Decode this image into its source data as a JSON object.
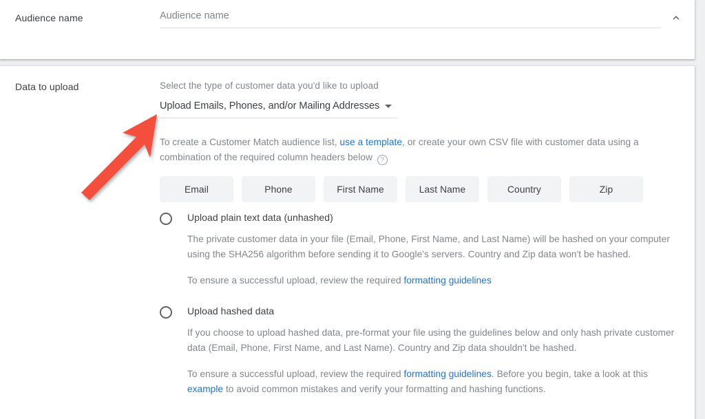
{
  "audience_section": {
    "label": "Audience name",
    "input_placeholder": "Audience name",
    "input_value": "",
    "collapse_icon": "chevron-up-icon"
  },
  "data_section": {
    "label": "Data to upload",
    "select_hint": "Select the type of customer data you'd like to upload",
    "type_select": {
      "value": "Upload Emails, Phones, and/or Mailing Addresses",
      "caret_icon": "chevron-down-icon"
    },
    "description": {
      "part1": "To create a Customer Match audience list, ",
      "link": "use a template",
      "part2": ", or create your own CSV file with customer data using a combination of the required column headers below ",
      "help_icon": "help-circle-icon",
      "help_glyph": "?"
    },
    "column_header_chips": [
      "Email",
      "Phone",
      "First Name",
      "Last Name",
      "Country",
      "Zip"
    ],
    "options": [
      {
        "id": "plain",
        "title": "Upload plain text data (unhashed)",
        "selected": false,
        "paragraph1": "The private customer data in your file (Email, Phone, First Name, and Last Name) will be hashed on your computer using the SHA256 algorithm before sending it to Google's servers. Country and Zip data won't be hashed.",
        "paragraph2_pre": "To ensure a successful upload, review the required ",
        "paragraph2_link": "formatting guidelines",
        "paragraph2_post": ""
      },
      {
        "id": "hashed",
        "title": "Upload hashed data",
        "selected": false,
        "paragraph1": "If you choose to upload hashed data, pre-format your file using the guidelines below and only hash private customer data (Email, Phone, First Name, and Last Name). Country and Zip data shouldn't be hashed.",
        "paragraph2_pre": "To ensure a successful upload, review the required ",
        "paragraph2_link": "formatting guidelines",
        "paragraph2_mid": ". Before you begin, take a look at this ",
        "paragraph2_link2": "example",
        "paragraph2_post": " to avoid common mistakes and verify your formatting and hashing functions."
      }
    ]
  },
  "annotation": {
    "type": "arrow",
    "color": "#f4503c",
    "points_to": "type-select-dropdown"
  },
  "colors": {
    "link": "#1a73e8",
    "text_primary": "#3c4043",
    "text_secondary": "#80868b",
    "chip_bg": "#f1f3f4",
    "page_bg": "#eef0f1",
    "card_bg": "#ffffff",
    "annotation_red": "#f4503c"
  }
}
